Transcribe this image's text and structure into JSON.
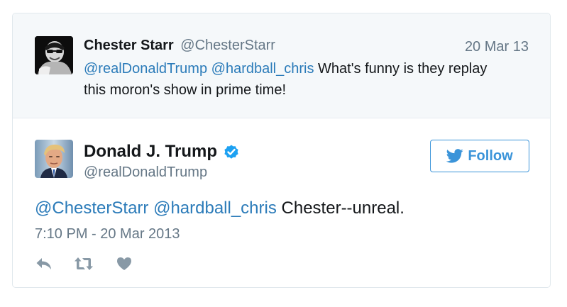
{
  "parent_tweet": {
    "author_name": "Chester Starr",
    "author_handle": "@ChesterStarr",
    "date": "20 Mar 13",
    "mention_1": "@realDonaldTrump",
    "mention_2": "@hardball_chris",
    "text_line_1": "What's funny is they replay",
    "text_line_2": "this moron's show in prime time!"
  },
  "tweet": {
    "author_name": "Donald J. Trump",
    "author_handle": "@realDonaldTrump",
    "verified": true,
    "mention_1": "@ChesterStarr",
    "mention_2": "@hardball_chris",
    "text": "Chester--unreal.",
    "timestamp": "7:10 PM - 20 Mar 2013"
  },
  "follow_button": {
    "label": "Follow"
  },
  "actions": {
    "icons": [
      "reply-icon",
      "retweet-icon",
      "heart-icon"
    ]
  },
  "colors": {
    "link": "#2b7bb9",
    "follow": "#3b94d9",
    "secondary_text": "#657786",
    "action_icon": "#8899a6",
    "parent_background": "#f5f8fa",
    "verified": "#1da1f2"
  }
}
